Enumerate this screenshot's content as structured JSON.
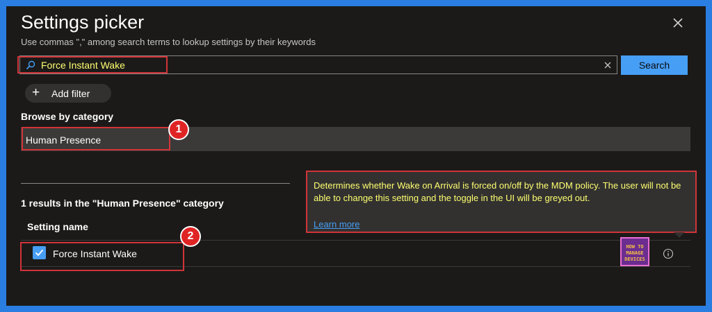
{
  "header": {
    "title": "Settings picker",
    "subtitle": "Use commas \",\" among search terms to lookup settings by their keywords"
  },
  "search": {
    "value": "Force Instant Wake",
    "button_label": "Search"
  },
  "filter": {
    "add_label": "Add filter"
  },
  "browse": {
    "label": "Browse by category",
    "categories": [
      {
        "label": "Human Presence",
        "selected": true
      }
    ]
  },
  "results": {
    "summary": "1 results in the \"Human Presence\" category",
    "column_header": "Setting name",
    "rows": [
      {
        "name": "Force Instant Wake",
        "checked": true
      }
    ]
  },
  "tooltip": {
    "description": "Determines whether Wake on Arrival is forced on/off by the MDM policy. The user will not be able to change this setting and the toggle in the UI will be greyed out.",
    "link_label": "Learn more"
  },
  "watermark": {
    "line1": "HOW TO",
    "line2": "MANAGE",
    "line3": "DEVICES"
  },
  "annotations": {
    "badge_1": "1",
    "badge_2": "2"
  },
  "colors": {
    "accent": "#479ef5",
    "panel_bg": "#1b1a19",
    "frame": "#2a7de1",
    "highlight_text": "#ffff70",
    "annotation_red": "#d13438"
  },
  "icons": [
    "close-icon",
    "search-icon",
    "clear-icon",
    "plus-icon",
    "checkmark-icon",
    "info-icon"
  ]
}
